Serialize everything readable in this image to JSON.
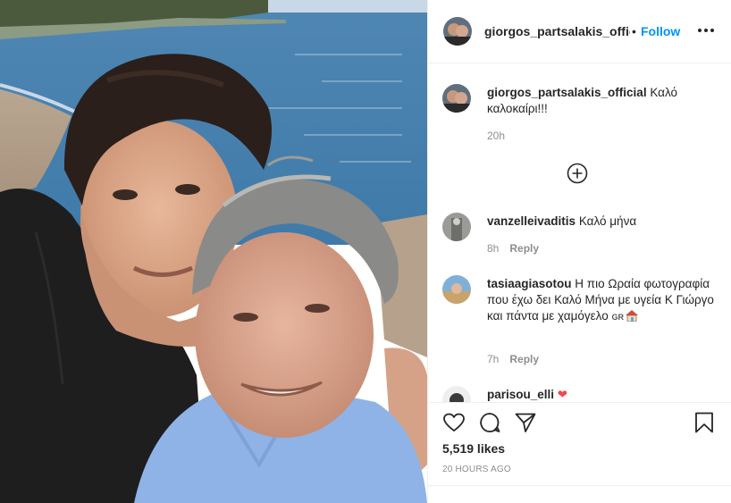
{
  "post": {
    "image_alt": "selfie on the beach"
  },
  "header": {
    "username": "giorgos_partsalakis_officia",
    "separator": "•",
    "follow_label": "Follow",
    "more_icon": "more-horizontal-icon"
  },
  "caption": {
    "username": "giorgos_partsalakis_official",
    "text": "Καλό καλοκαίρι!!!",
    "time": "20h"
  },
  "load_more_icon": "plus-circle-icon",
  "comments": [
    {
      "username": "vanzelleivaditis",
      "text": "Καλό μήνα",
      "time": "8h",
      "reply_label": "Reply"
    },
    {
      "username": "tasiaagiasotou",
      "text": "Η πιο Ωραία φωτογραφία που έχω δει Καλό Μήνα με υγεία Κ Γιώργο και πάντα με χαμόγελο",
      "flag_text": "GR",
      "time": "7h",
      "reply_label": "Reply"
    },
    {
      "username": "parisou_elli",
      "emoji": "❤"
    }
  ],
  "actions": {
    "like_icon": "heart-icon",
    "comment_icon": "comment-icon",
    "share_icon": "paper-plane-icon",
    "save_icon": "bookmark-icon"
  },
  "likes_text": "5,519 likes",
  "time_ago": "20 HOURS AGO",
  "colors": {
    "follow": "#0095f6",
    "heart": "#ed4956",
    "muted": "#8e8e8e"
  }
}
